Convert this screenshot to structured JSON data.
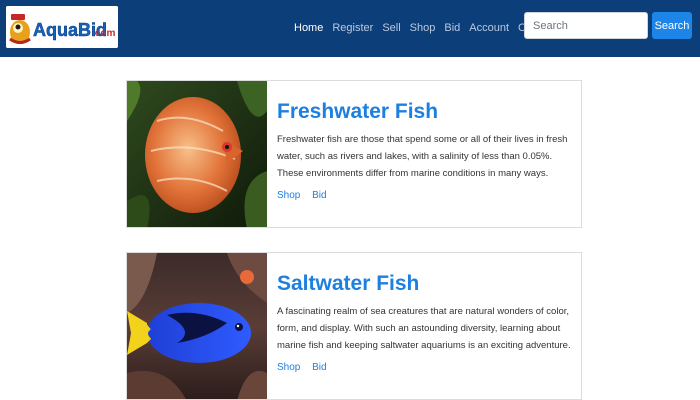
{
  "brand": {
    "logo_text": "AquaBid",
    "logo_suffix": ".com"
  },
  "nav": {
    "links": [
      "Home",
      "Register",
      "Sell",
      "Shop",
      "Bid",
      "Account",
      "Cart"
    ],
    "active": "Home"
  },
  "search": {
    "placeholder": "Search",
    "button_label": "Search"
  },
  "colors": {
    "navbar": "#0c3f79",
    "accent": "#1d7fe0",
    "button": "#1d85e8"
  },
  "cards": [
    {
      "title": "Freshwater Fish",
      "text": "Freshwater fish are those that spend some or all of their lives in fresh water, such as rivers and lakes, with a salinity of less than 0.05%. These environments differ from marine conditions in many ways.",
      "links": [
        "Shop",
        "Bid"
      ]
    },
    {
      "title": "Saltwater Fish",
      "text": "A fascinating realm of sea creatures that are natural wonders of color, form, and display. With such an astounding diversity, learning about marine fish and keeping saltwater aquariums is an exciting adventure.",
      "links": [
        "Shop",
        "Bid"
      ]
    }
  ]
}
